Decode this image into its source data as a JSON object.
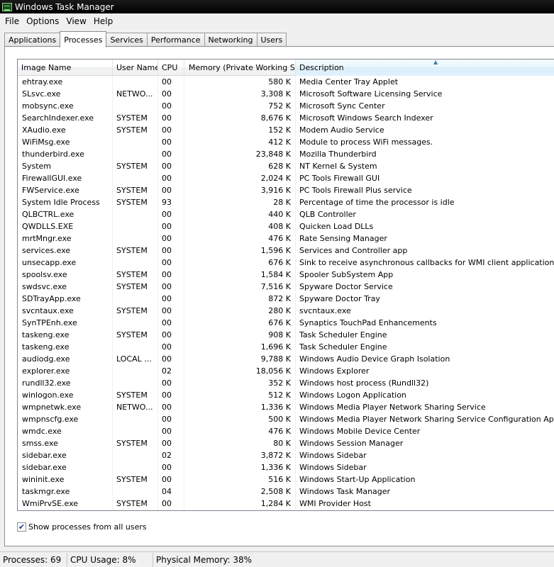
{
  "window": {
    "title": "Windows Task Manager"
  },
  "menu": [
    "File",
    "Options",
    "View",
    "Help"
  ],
  "tabs": [
    {
      "label": "Applications",
      "active": false
    },
    {
      "label": "Processes",
      "active": true
    },
    {
      "label": "Services",
      "active": false
    },
    {
      "label": "Performance",
      "active": false
    },
    {
      "label": "Networking",
      "active": false
    },
    {
      "label": "Users",
      "active": false
    }
  ],
  "columns": {
    "name": "Image Name",
    "user": "User Name",
    "cpu": "CPU",
    "memory": "Memory (Private Working Set)",
    "description": "Description"
  },
  "processes": [
    {
      "name": "ehtray.exe",
      "user": "",
      "cpu": "00",
      "memory": "580 K",
      "description": "Media Center Tray Applet"
    },
    {
      "name": "SLsvc.exe",
      "user": "NETWO...",
      "cpu": "00",
      "memory": "3,308 K",
      "description": "Microsoft Software Licensing Service"
    },
    {
      "name": "mobsync.exe",
      "user": "",
      "cpu": "00",
      "memory": "752 K",
      "description": "Microsoft Sync Center"
    },
    {
      "name": "SearchIndexer.exe",
      "user": "SYSTEM",
      "cpu": "00",
      "memory": "8,676 K",
      "description": "Microsoft Windows Search Indexer"
    },
    {
      "name": "XAudio.exe",
      "user": "SYSTEM",
      "cpu": "00",
      "memory": "152 K",
      "description": "Modem Audio Service"
    },
    {
      "name": "WiFiMsg.exe",
      "user": "",
      "cpu": "00",
      "memory": "412 K",
      "description": "Module to process WiFi messages."
    },
    {
      "name": "thunderbird.exe",
      "user": "",
      "cpu": "00",
      "memory": "23,848 K",
      "description": "Mozilla Thunderbird"
    },
    {
      "name": "System",
      "user": "SYSTEM",
      "cpu": "00",
      "memory": "628 K",
      "description": "NT Kernel & System"
    },
    {
      "name": "FirewallGUI.exe",
      "user": "",
      "cpu": "00",
      "memory": "2,024 K",
      "description": "PC Tools Firewall GUI"
    },
    {
      "name": "FWService.exe",
      "user": "SYSTEM",
      "cpu": "00",
      "memory": "3,916 K",
      "description": "PC Tools Firewall Plus service"
    },
    {
      "name": "System Idle Process",
      "user": "SYSTEM",
      "cpu": "93",
      "memory": "28 K",
      "description": "Percentage of time the processor is idle"
    },
    {
      "name": "QLBCTRL.exe",
      "user": "",
      "cpu": "00",
      "memory": "440 K",
      "description": "QLB Controller"
    },
    {
      "name": "QWDLLS.EXE",
      "user": "",
      "cpu": "00",
      "memory": "408 K",
      "description": "Quicken Load DLLs"
    },
    {
      "name": "mrtMngr.exe",
      "user": "",
      "cpu": "00",
      "memory": "476 K",
      "description": "Rate Sensing Manager"
    },
    {
      "name": "services.exe",
      "user": "SYSTEM",
      "cpu": "00",
      "memory": "1,596 K",
      "description": "Services and Controller app"
    },
    {
      "name": "unsecapp.exe",
      "user": "",
      "cpu": "00",
      "memory": "676 K",
      "description": "Sink to receive asynchronous callbacks for WMI client application"
    },
    {
      "name": "spoolsv.exe",
      "user": "SYSTEM",
      "cpu": "00",
      "memory": "1,584 K",
      "description": "Spooler SubSystem App"
    },
    {
      "name": "swdsvc.exe",
      "user": "SYSTEM",
      "cpu": "00",
      "memory": "7,516 K",
      "description": "Spyware Doctor Service"
    },
    {
      "name": "SDTrayApp.exe",
      "user": "",
      "cpu": "00",
      "memory": "872 K",
      "description": "Spyware Doctor Tray"
    },
    {
      "name": "svcntaux.exe",
      "user": "SYSTEM",
      "cpu": "00",
      "memory": "280 K",
      "description": "svcntaux.exe"
    },
    {
      "name": "SynTPEnh.exe",
      "user": "",
      "cpu": "00",
      "memory": "676 K",
      "description": "Synaptics TouchPad Enhancements"
    },
    {
      "name": "taskeng.exe",
      "user": "SYSTEM",
      "cpu": "00",
      "memory": "908 K",
      "description": "Task Scheduler Engine"
    },
    {
      "name": "taskeng.exe",
      "user": "",
      "cpu": "00",
      "memory": "1,696 K",
      "description": "Task Scheduler Engine"
    },
    {
      "name": "audiodg.exe",
      "user": "LOCAL ...",
      "cpu": "00",
      "memory": "9,788 K",
      "description": "Windows Audio Device Graph Isolation"
    },
    {
      "name": "explorer.exe",
      "user": "",
      "cpu": "02",
      "memory": "18,056 K",
      "description": "Windows Explorer"
    },
    {
      "name": "rundll32.exe",
      "user": "",
      "cpu": "00",
      "memory": "352 K",
      "description": "Windows host process (Rundll32)"
    },
    {
      "name": "winlogon.exe",
      "user": "SYSTEM",
      "cpu": "00",
      "memory": "512 K",
      "description": "Windows Logon Application"
    },
    {
      "name": "wmpnetwk.exe",
      "user": "NETWO...",
      "cpu": "00",
      "memory": "1,336 K",
      "description": "Windows Media Player Network Sharing Service"
    },
    {
      "name": "wmpnscfg.exe",
      "user": "",
      "cpu": "00",
      "memory": "500 K",
      "description": "Windows Media Player Network Sharing Service Configuration Application"
    },
    {
      "name": "wmdc.exe",
      "user": "",
      "cpu": "00",
      "memory": "476 K",
      "description": "Windows Mobile Device Center"
    },
    {
      "name": "smss.exe",
      "user": "SYSTEM",
      "cpu": "00",
      "memory": "80 K",
      "description": "Windows Session Manager"
    },
    {
      "name": "sidebar.exe",
      "user": "",
      "cpu": "02",
      "memory": "3,872 K",
      "description": "Windows Sidebar"
    },
    {
      "name": "sidebar.exe",
      "user": "",
      "cpu": "00",
      "memory": "1,336 K",
      "description": "Windows Sidebar"
    },
    {
      "name": "wininit.exe",
      "user": "SYSTEM",
      "cpu": "00",
      "memory": "516 K",
      "description": "Windows Start-Up Application"
    },
    {
      "name": "taskmgr.exe",
      "user": "",
      "cpu": "04",
      "memory": "2,508 K",
      "description": "Windows Task Manager"
    },
    {
      "name": "WmiPrvSE.exe",
      "user": "SYSTEM",
      "cpu": "00",
      "memory": "1,284 K",
      "description": "WMI Provider Host"
    }
  ],
  "show_all_users": {
    "label": "Show processes from all users",
    "checked": true
  },
  "status": {
    "processes": "Processes: 69",
    "cpu": "CPU Usage: 8%",
    "memory": "Physical Memory: 38%"
  }
}
